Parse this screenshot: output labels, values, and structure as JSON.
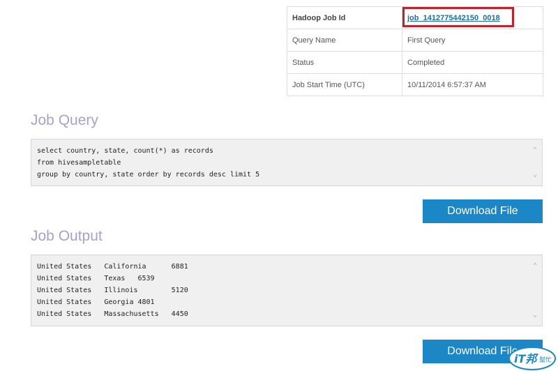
{
  "job_info": {
    "rows": [
      {
        "label": "Hadoop Job Id",
        "value": "job_1412775442150_0018"
      },
      {
        "label": "Query Name",
        "value": "First Query"
      },
      {
        "label": "Status",
        "value": "Completed"
      },
      {
        "label": "Job Start Time (UTC)",
        "value": "10/11/2014 6:57:37 AM"
      }
    ]
  },
  "job_query": {
    "heading": "Job Query",
    "lines": [
      "select country, state, count(*) as records",
      "from hivesampletable",
      "group by country, state order by records desc limit 5"
    ],
    "download_label": "Download File"
  },
  "job_output": {
    "heading": "Job Output",
    "lines": [
      "United States   California      6881",
      "United States   Texas   6539",
      "United States   Illinois        5120",
      "United States   Georgia 4801",
      "United States   Massachusetts   4450"
    ],
    "download_label": "Download File"
  },
  "watermark": {
    "text": "iT邦",
    "subtext": "幫忙"
  },
  "colors": {
    "accent": "#1b87c7",
    "heading": "#a99fd0",
    "highlight": "#c0232c"
  }
}
